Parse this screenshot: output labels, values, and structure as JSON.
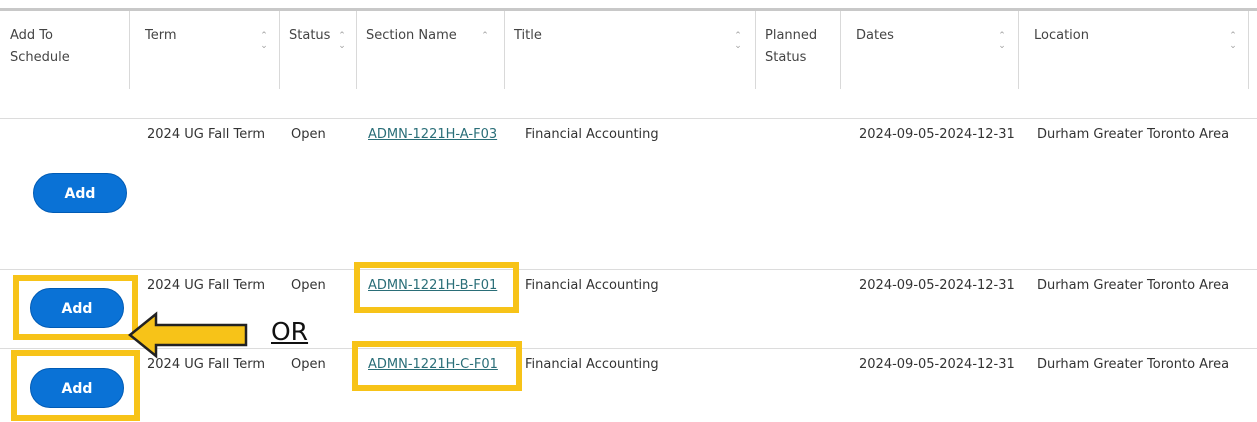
{
  "table": {
    "headers": {
      "add_to_schedule": [
        "Add To",
        "Schedule"
      ],
      "term": "Term",
      "status": "Status",
      "section_name": "Section Name",
      "title": "Title",
      "planned_status": [
        "Planned",
        "Status"
      ],
      "dates": "Dates",
      "location": "Location"
    },
    "rows": [
      {
        "term": "2024 UG Fall Term",
        "status": "Open",
        "section_name": "ADMN-1221H-A-F03",
        "title": "Financial Accounting",
        "dates": "2024-09-05-2024-12-31",
        "location": "Durham Greater Toronto Area",
        "add_label": "Add"
      },
      {
        "term": "2024 UG Fall Term",
        "status": "Open",
        "section_name": "ADMN-1221H-B-F01",
        "title": "Financial Accounting",
        "dates": "2024-09-05-2024-12-31",
        "location": "Durham Greater Toronto Area",
        "add_label": "Add"
      },
      {
        "term": "2024 UG Fall Term",
        "status": "Open",
        "section_name": "ADMN-1221H-C-F01",
        "title": "Financial Accounting",
        "dates": "2024-09-05-2024-12-31",
        "location": "Durham Greater Toronto Area",
        "add_label": "Add"
      }
    ]
  },
  "annotation": {
    "or_text": "OR",
    "highlight_color": "#f7c318",
    "arrow_color": "#f7c318"
  },
  "colors": {
    "button": "#0a72d6",
    "link": "#2a6e78"
  },
  "icons": {
    "sort": "sort-arrows-icon",
    "arrow": "left-arrow-icon"
  }
}
